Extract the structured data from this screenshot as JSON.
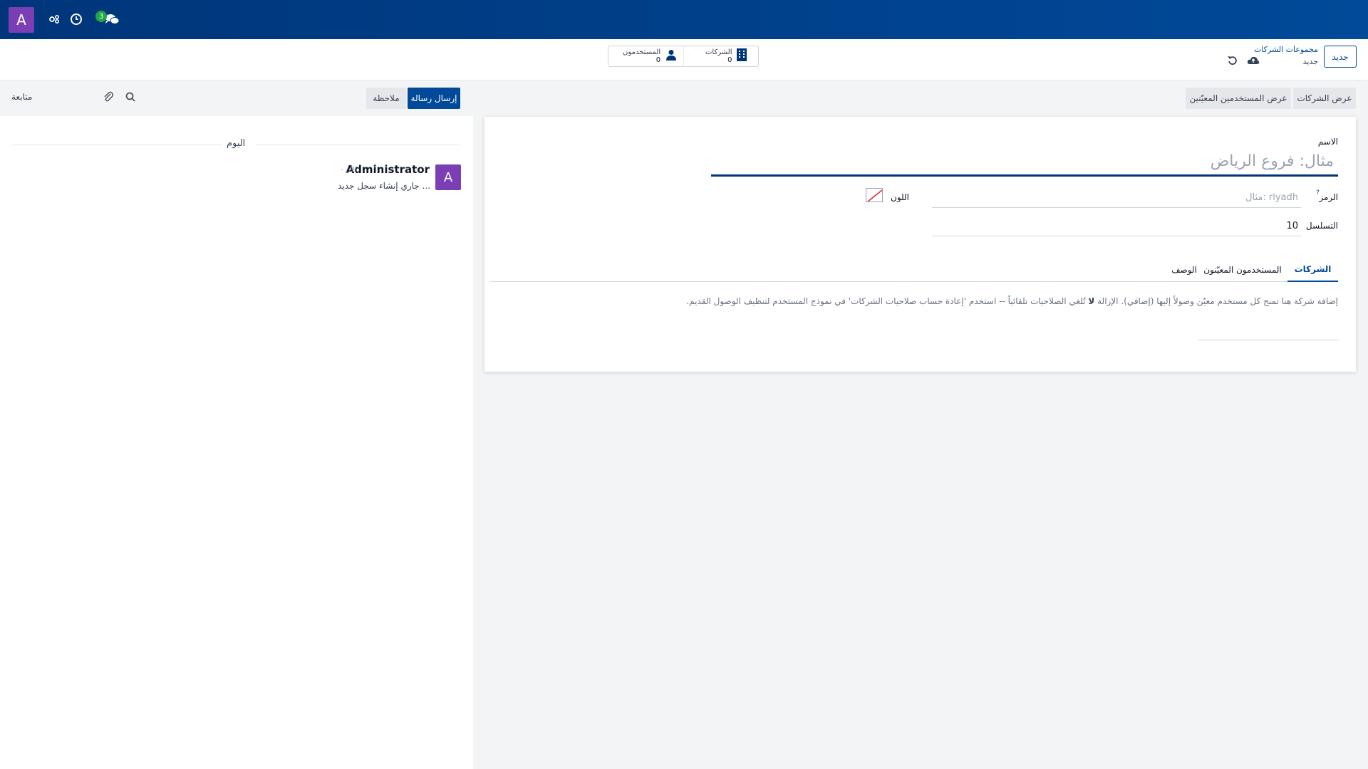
{
  "navbar": {
    "avatar_letter": "A",
    "icons": [
      "people-gear-icon",
      "clock-icon",
      "chat-bubbles-icon"
    ],
    "chat_badge": "3",
    "bg_color": "#00418a"
  },
  "control_panel": {
    "new_button": "جديد",
    "breadcrumb_parent": "مجموعات الشركات",
    "breadcrumb_current": "جديد",
    "stats": {
      "companies_label": "الشركات",
      "companies_count": "0",
      "users_label": "المستخدمون",
      "users_count": "0"
    }
  },
  "chatter": {
    "send_message": "إرسال رسالة",
    "log_note": "ملاحظة",
    "follow": "متابعة",
    "date_separator": "اليوم",
    "message": {
      "avatar_letter": "A",
      "author": "Administrator",
      "time": "- الآن",
      "body": "جاري إنشاء سجل جديد ..."
    }
  },
  "form": {
    "smart_buttons": {
      "view_companies": "عرض الشركات",
      "view_assigned_users": "عرض المستخدمين المعيّنين"
    },
    "name_label": "الاسم",
    "name_placeholder": "مثال: فروع الرياض",
    "code_label": "الرمز",
    "code_help": "?",
    "code_placeholder": "مثال: riyadh",
    "color_label": "اللون",
    "sequence_label": "التسلسل",
    "sequence_value": "10",
    "tabs": [
      "الشركات",
      "المستخدمون المعيّنون",
      "الوصف"
    ],
    "active_tab": "الشركات",
    "companies_help_prefix": "إضافة شركة هنا تمنح كل مستخدم معيّن وصولاً إليها (إضافي). الإزالة ",
    "companies_help_bold": "لا",
    "companies_help_suffix": " تُلغي الصلاحيات تلقائياً -- استخدم 'إعادة حساب صلاحيات الشركات' في نموذج المستخدم لتنظيف الوصول القديم."
  }
}
